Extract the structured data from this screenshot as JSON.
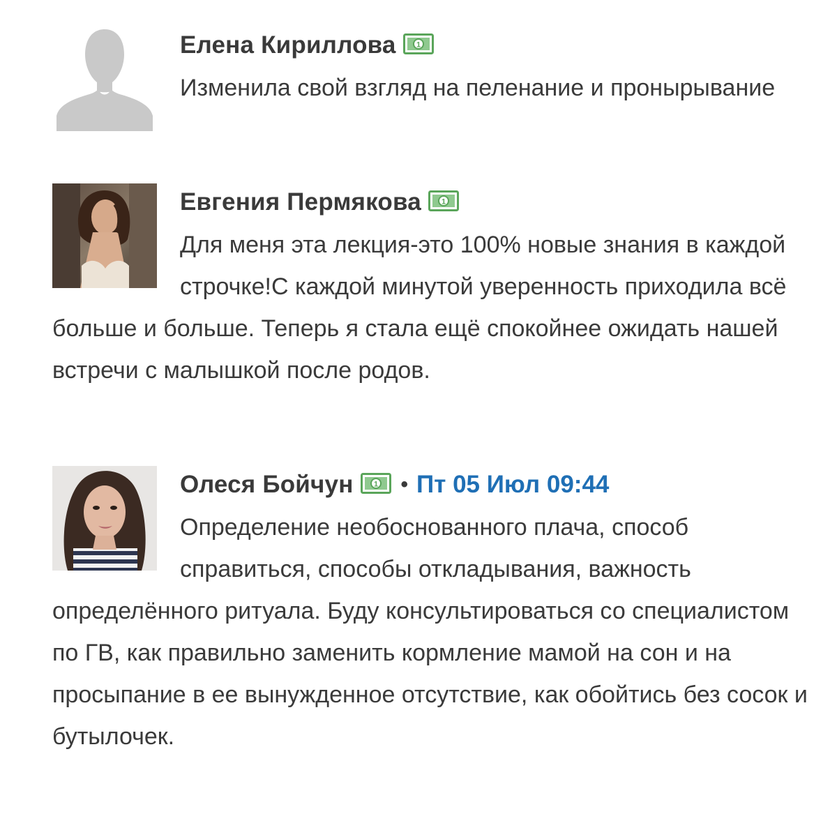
{
  "colors": {
    "text": "#3a3a3a",
    "timestamp": "#1f6fb5",
    "badge_green": "#5aa55a",
    "placeholder_avatar": "#c9c9c9"
  },
  "comments": [
    {
      "author": "Елена Кириллова",
      "avatar": "default-silhouette",
      "badge_icon": "money-banknote-icon",
      "timestamp": "",
      "text": "Изменила свой взгляд на пеленание и пронырывание"
    },
    {
      "author": "Евгения Пермякова",
      "avatar": "user-photo",
      "badge_icon": "money-banknote-icon",
      "timestamp": "",
      "text": "Для меня эта лекция-это 100% новые знания в каждой строчке!С каждой минутой уверенность приходила всё больше и больше. Теперь я стала ещё спокойнее ожидать нашей встречи с малышкой после родов."
    },
    {
      "author": "Олеся Бойчун",
      "avatar": "user-photo",
      "badge_icon": "money-banknote-icon",
      "separator": "•",
      "timestamp": "Пт 05 Июл 09:44",
      "text": "Определение необоснованного плача, способ справиться, способы откладывания, важность определённого ритуала. Буду консультироваться со специалистом по ГВ, как правильно заменить кормление мамой на сон и на просыпание в ее вынужденное отсутствие, как обойтись без сосок и бутылочек."
    }
  ]
}
